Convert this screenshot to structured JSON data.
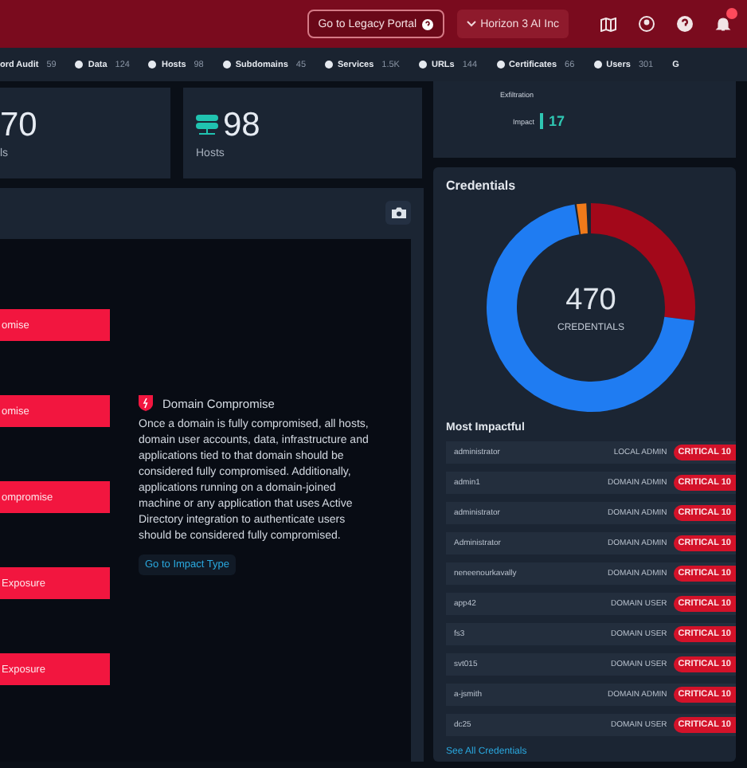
{
  "header": {
    "legacy_button": "Go to Legacy Portal",
    "org_selector": "Horizon 3 AI Inc",
    "notification_badge": true
  },
  "nav": [
    {
      "label": "ord Audit",
      "count": "59"
    },
    {
      "label": "Data",
      "count": "124"
    },
    {
      "label": "Hosts",
      "count": "98"
    },
    {
      "label": "Subdomains",
      "count": "45"
    },
    {
      "label": "Services",
      "count": "1.5K"
    },
    {
      "label": "URLs",
      "count": "144"
    },
    {
      "label": "Certificates",
      "count": "66"
    },
    {
      "label": "Users",
      "count": "301"
    },
    {
      "label": "G"
    }
  ],
  "stats": [
    {
      "value": "70",
      "label": "ls",
      "icon": false
    },
    {
      "value": "98",
      "label": "Hosts",
      "icon": true
    }
  ],
  "impact_card": {
    "exfiltration_label": "Exfiltration",
    "impact_label": "Impact",
    "impact_value": "17"
  },
  "impact_panel": {
    "bars": [
      "omise",
      "omise",
      "ompromise",
      "Exposure",
      "Exposure"
    ],
    "detail": {
      "title": "Domain Compromise",
      "text": "Once a domain is fully compromised, all hosts, domain user accounts, data, infrastructure and applications tied to that domain should be considered fully compromised. Additionally, applications running on a domain-joined machine or any application that uses Active Directory integration to authenticate users should be considered fully compromised.",
      "link": "Go to Impact Type"
    }
  },
  "credentials": {
    "title": "Credentials",
    "total": "470",
    "total_label": "CREDENTIALS",
    "list_title": "Most Impactful",
    "rows": [
      {
        "name": "administrator",
        "role": "LOCAL ADMIN",
        "severity": "CRITICAL 10"
      },
      {
        "name": "admin1",
        "role": "DOMAIN ADMIN",
        "severity": "CRITICAL 10"
      },
      {
        "name": "administrator",
        "role": "DOMAIN ADMIN",
        "severity": "CRITICAL 10"
      },
      {
        "name": "Administrator",
        "role": "DOMAIN ADMIN",
        "severity": "CRITICAL 10"
      },
      {
        "name": "neneenourkavally",
        "role": "DOMAIN ADMIN",
        "severity": "CRITICAL 10"
      },
      {
        "name": "app42",
        "role": "DOMAIN USER",
        "severity": "CRITICAL 10"
      },
      {
        "name": "fs3",
        "role": "DOMAIN USER",
        "severity": "CRITICAL 10"
      },
      {
        "name": "svt015",
        "role": "DOMAIN USER",
        "severity": "CRITICAL 10"
      },
      {
        "name": "a-jsmith",
        "role": "DOMAIN ADMIN",
        "severity": "CRITICAL 10"
      },
      {
        "name": "dc25",
        "role": "DOMAIN USER",
        "severity": "CRITICAL 10"
      }
    ],
    "link": "See All Credentials"
  }
}
